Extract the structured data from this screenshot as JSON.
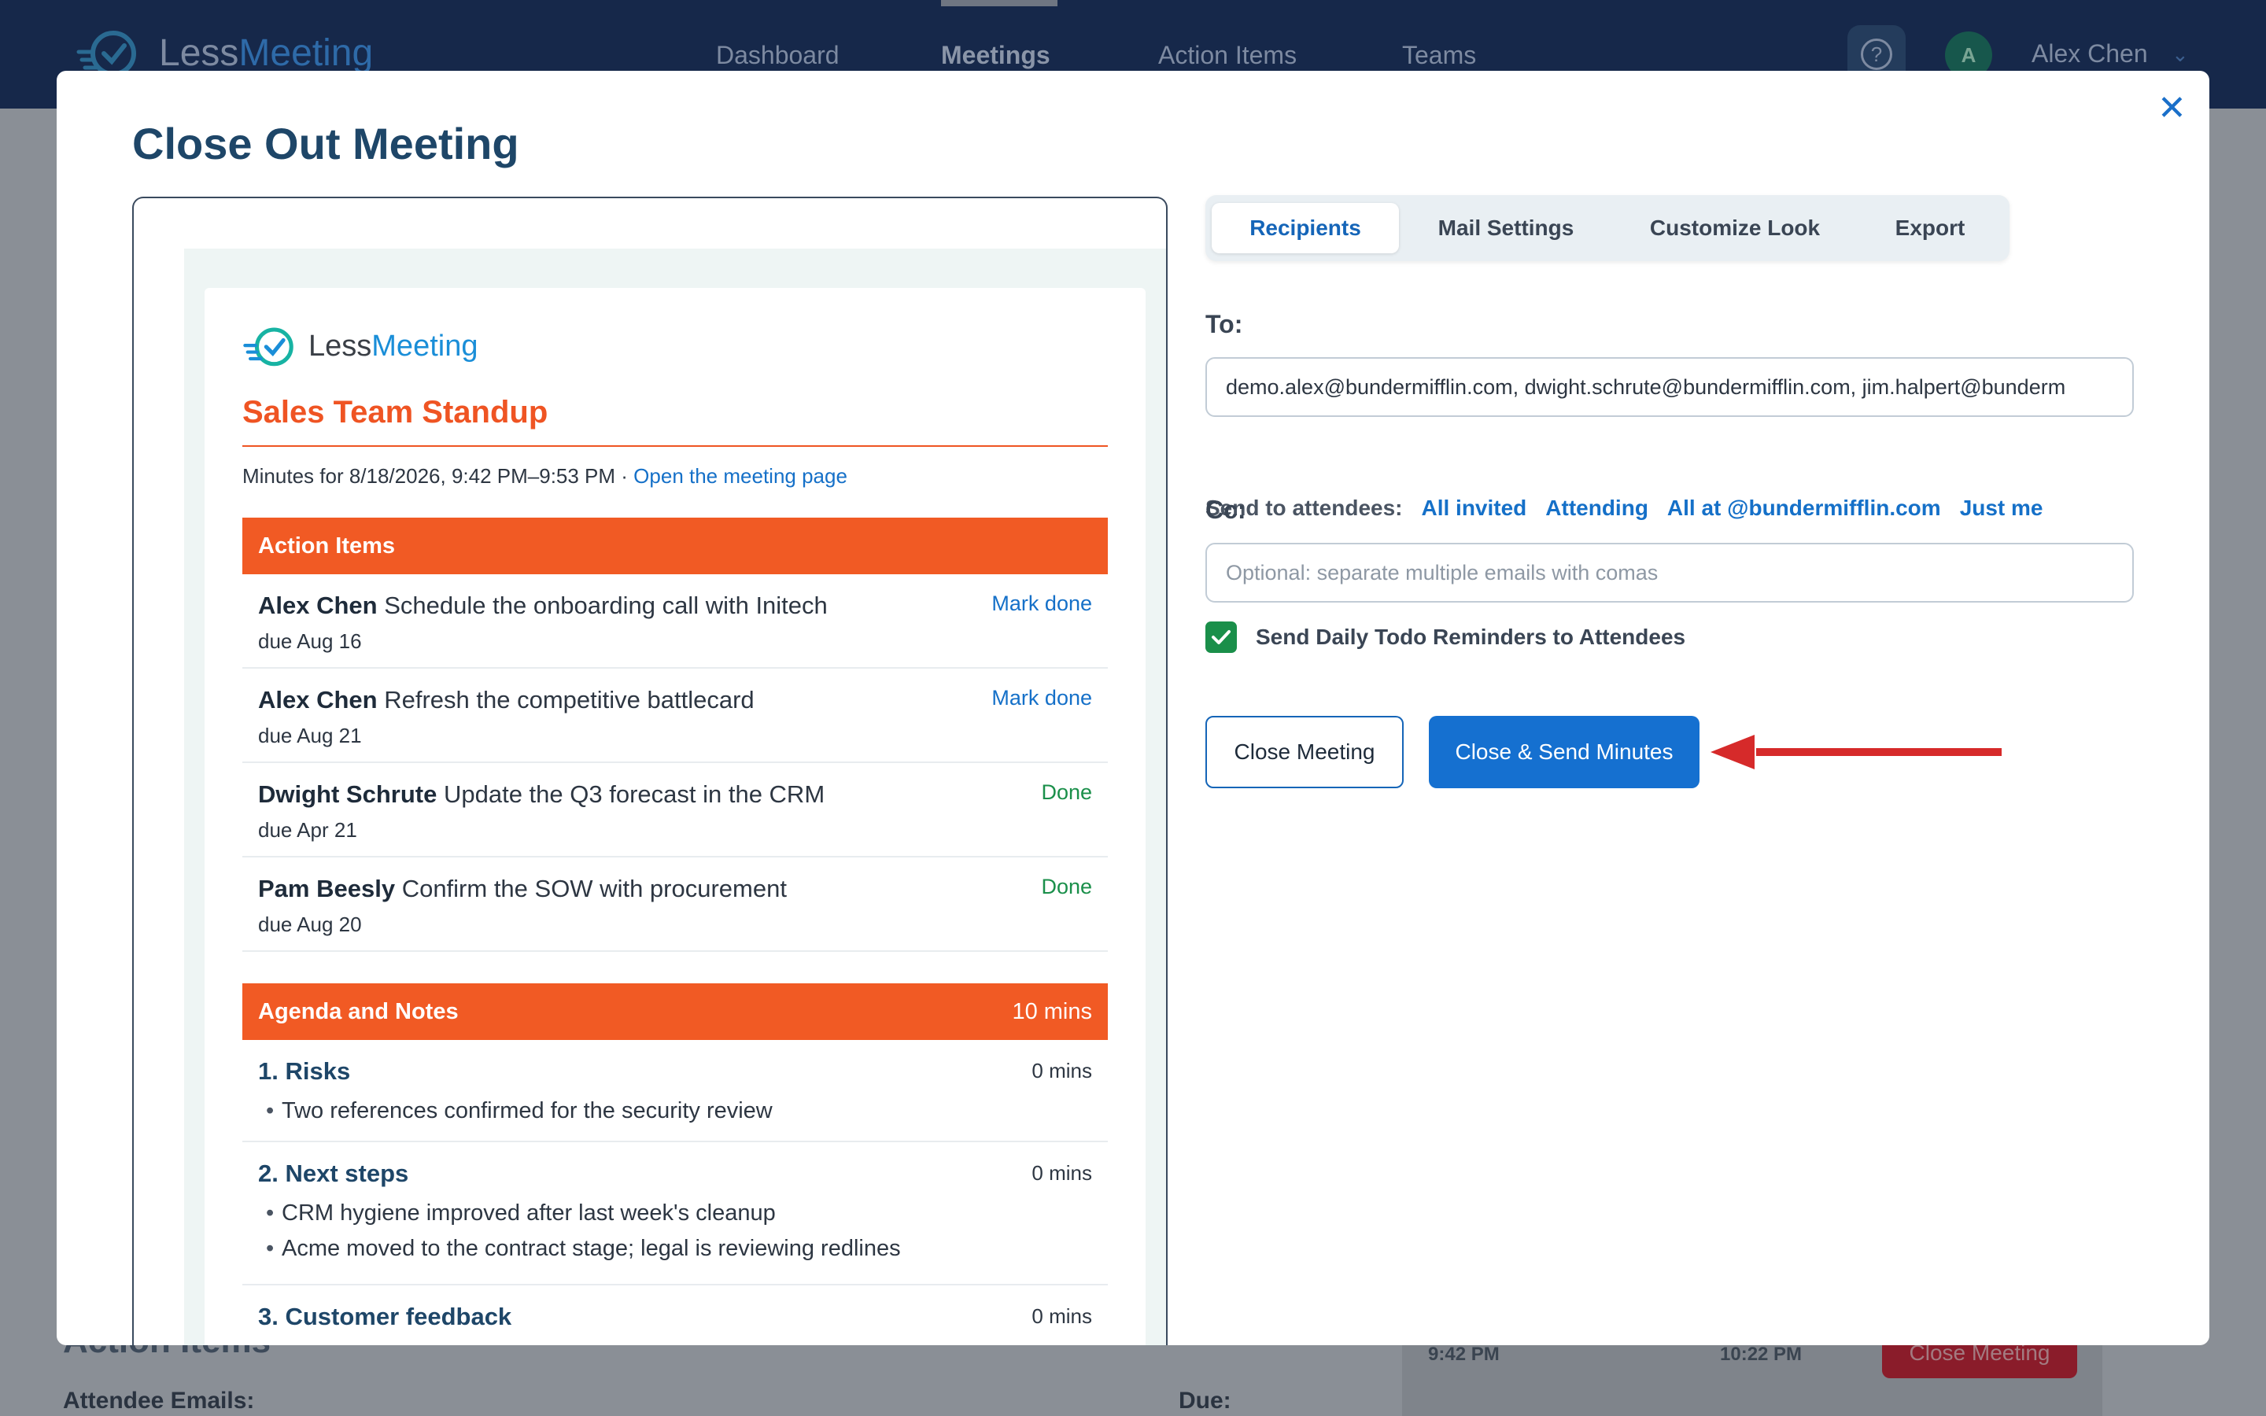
{
  "app": {
    "logo_less": "Less",
    "logo_meeting": "Meeting",
    "nav": [
      "Dashboard",
      "Meetings",
      "Action Items",
      "Teams"
    ],
    "active_nav": "Meetings",
    "help_glyph": "?",
    "avatar_initial": "A",
    "user_name": "Alex Chen",
    "background": {
      "section_heading": "Action Items",
      "attendee_emails_label": "Attendee Emails:",
      "due_label": "Due:",
      "start_time": "9:42 PM",
      "end_time": "10:22 PM",
      "close_button": "Close Meeting"
    }
  },
  "modal": {
    "title": "Close Out Meeting",
    "close_icon": "close-icon",
    "preview": {
      "logo_less": "Less",
      "logo_meeting": "Meeting",
      "meeting_title": "Sales Team Standup",
      "minutes_text": "Minutes for 8/18/2026, 9:42 PM–9:53 PM ·",
      "open_link": "Open the meeting page",
      "action_items_header": "Action Items",
      "action_items": [
        {
          "owner": "Alex Chen",
          "text": "Schedule the onboarding call with Initech",
          "due": "due Aug 16",
          "action": "Mark done",
          "done": false
        },
        {
          "owner": "Alex Chen",
          "text": "Refresh the competitive battlecard",
          "due": "due Aug 21",
          "action": "Mark done",
          "done": false
        },
        {
          "owner": "Dwight Schrute",
          "text": "Update the Q3 forecast in the CRM",
          "due": "due Apr 21",
          "action": "Done",
          "done": true
        },
        {
          "owner": "Pam Beesly",
          "text": "Confirm the SOW with procurement",
          "due": "due Aug 20",
          "action": "Done",
          "done": true
        }
      ],
      "agenda_header": "Agenda and Notes",
      "agenda_total": "10 mins",
      "agenda": [
        {
          "title": "1. Risks",
          "mins": "0 mins",
          "notes": [
            "Two references confirmed for the security review"
          ]
        },
        {
          "title": "2. Next steps",
          "mins": "0 mins",
          "notes": [
            "CRM hygiene improved after last week's cleanup",
            "Acme moved to the contract stage; legal is reviewing redlines"
          ]
        },
        {
          "title": "3. Customer feedback",
          "mins": "0 mins",
          "notes": []
        }
      ]
    },
    "tabs": [
      "Recipients",
      "Mail Settings",
      "Customize Look",
      "Export"
    ],
    "active_tab": "Recipients",
    "to_label": "To:",
    "to_value": "demo.alex@bundermifflin.com, dwight.schrute@bundermifflin.com, jim.halpert@bunderm",
    "send_to_label": "Send to attendees:",
    "send_to_options": [
      "All invited",
      "Attending",
      "All at @bundermifflin.com",
      "Just me"
    ],
    "cc_label": "Cc:",
    "cc_value": "",
    "cc_placeholder": "Optional: separate multiple emails with comas",
    "reminder_checked": true,
    "reminder_label": "Send Daily Todo Reminders to Attendees",
    "close_button": "Close Meeting",
    "send_button": "Close & Send Minutes",
    "colors": {
      "accent": "#1570d0",
      "brand_orange": "#f15a24",
      "done_green": "#1a8f4a",
      "arrow_red": "#d62a2a"
    }
  }
}
